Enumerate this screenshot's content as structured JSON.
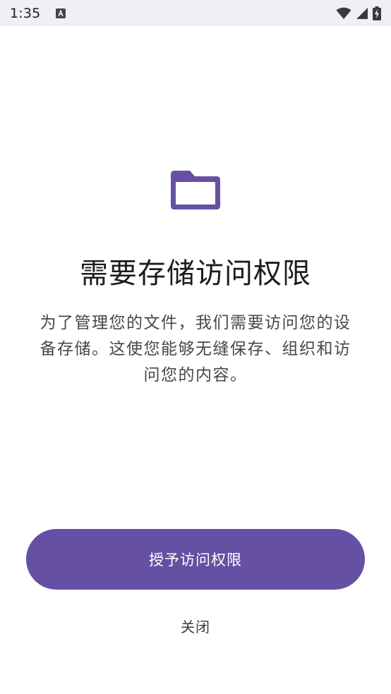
{
  "status_bar": {
    "time": "1:35",
    "icons": [
      "a-icon",
      "wifi-icon",
      "signal-icon",
      "battery-icon"
    ]
  },
  "content": {
    "icon": "folder-icon",
    "title": "需要存储访问权限",
    "description_lines": [
      "为了管理您的文件，我们需要访问您的设",
      "备存储。这使您能够无缝保存、组织和访",
      "问您的内容。"
    ]
  },
  "actions": {
    "grant_label": "授予访问权限",
    "close_label": "关闭"
  },
  "colors": {
    "accent": "#6650a4",
    "status_bar_bg": "#f2eef6"
  }
}
